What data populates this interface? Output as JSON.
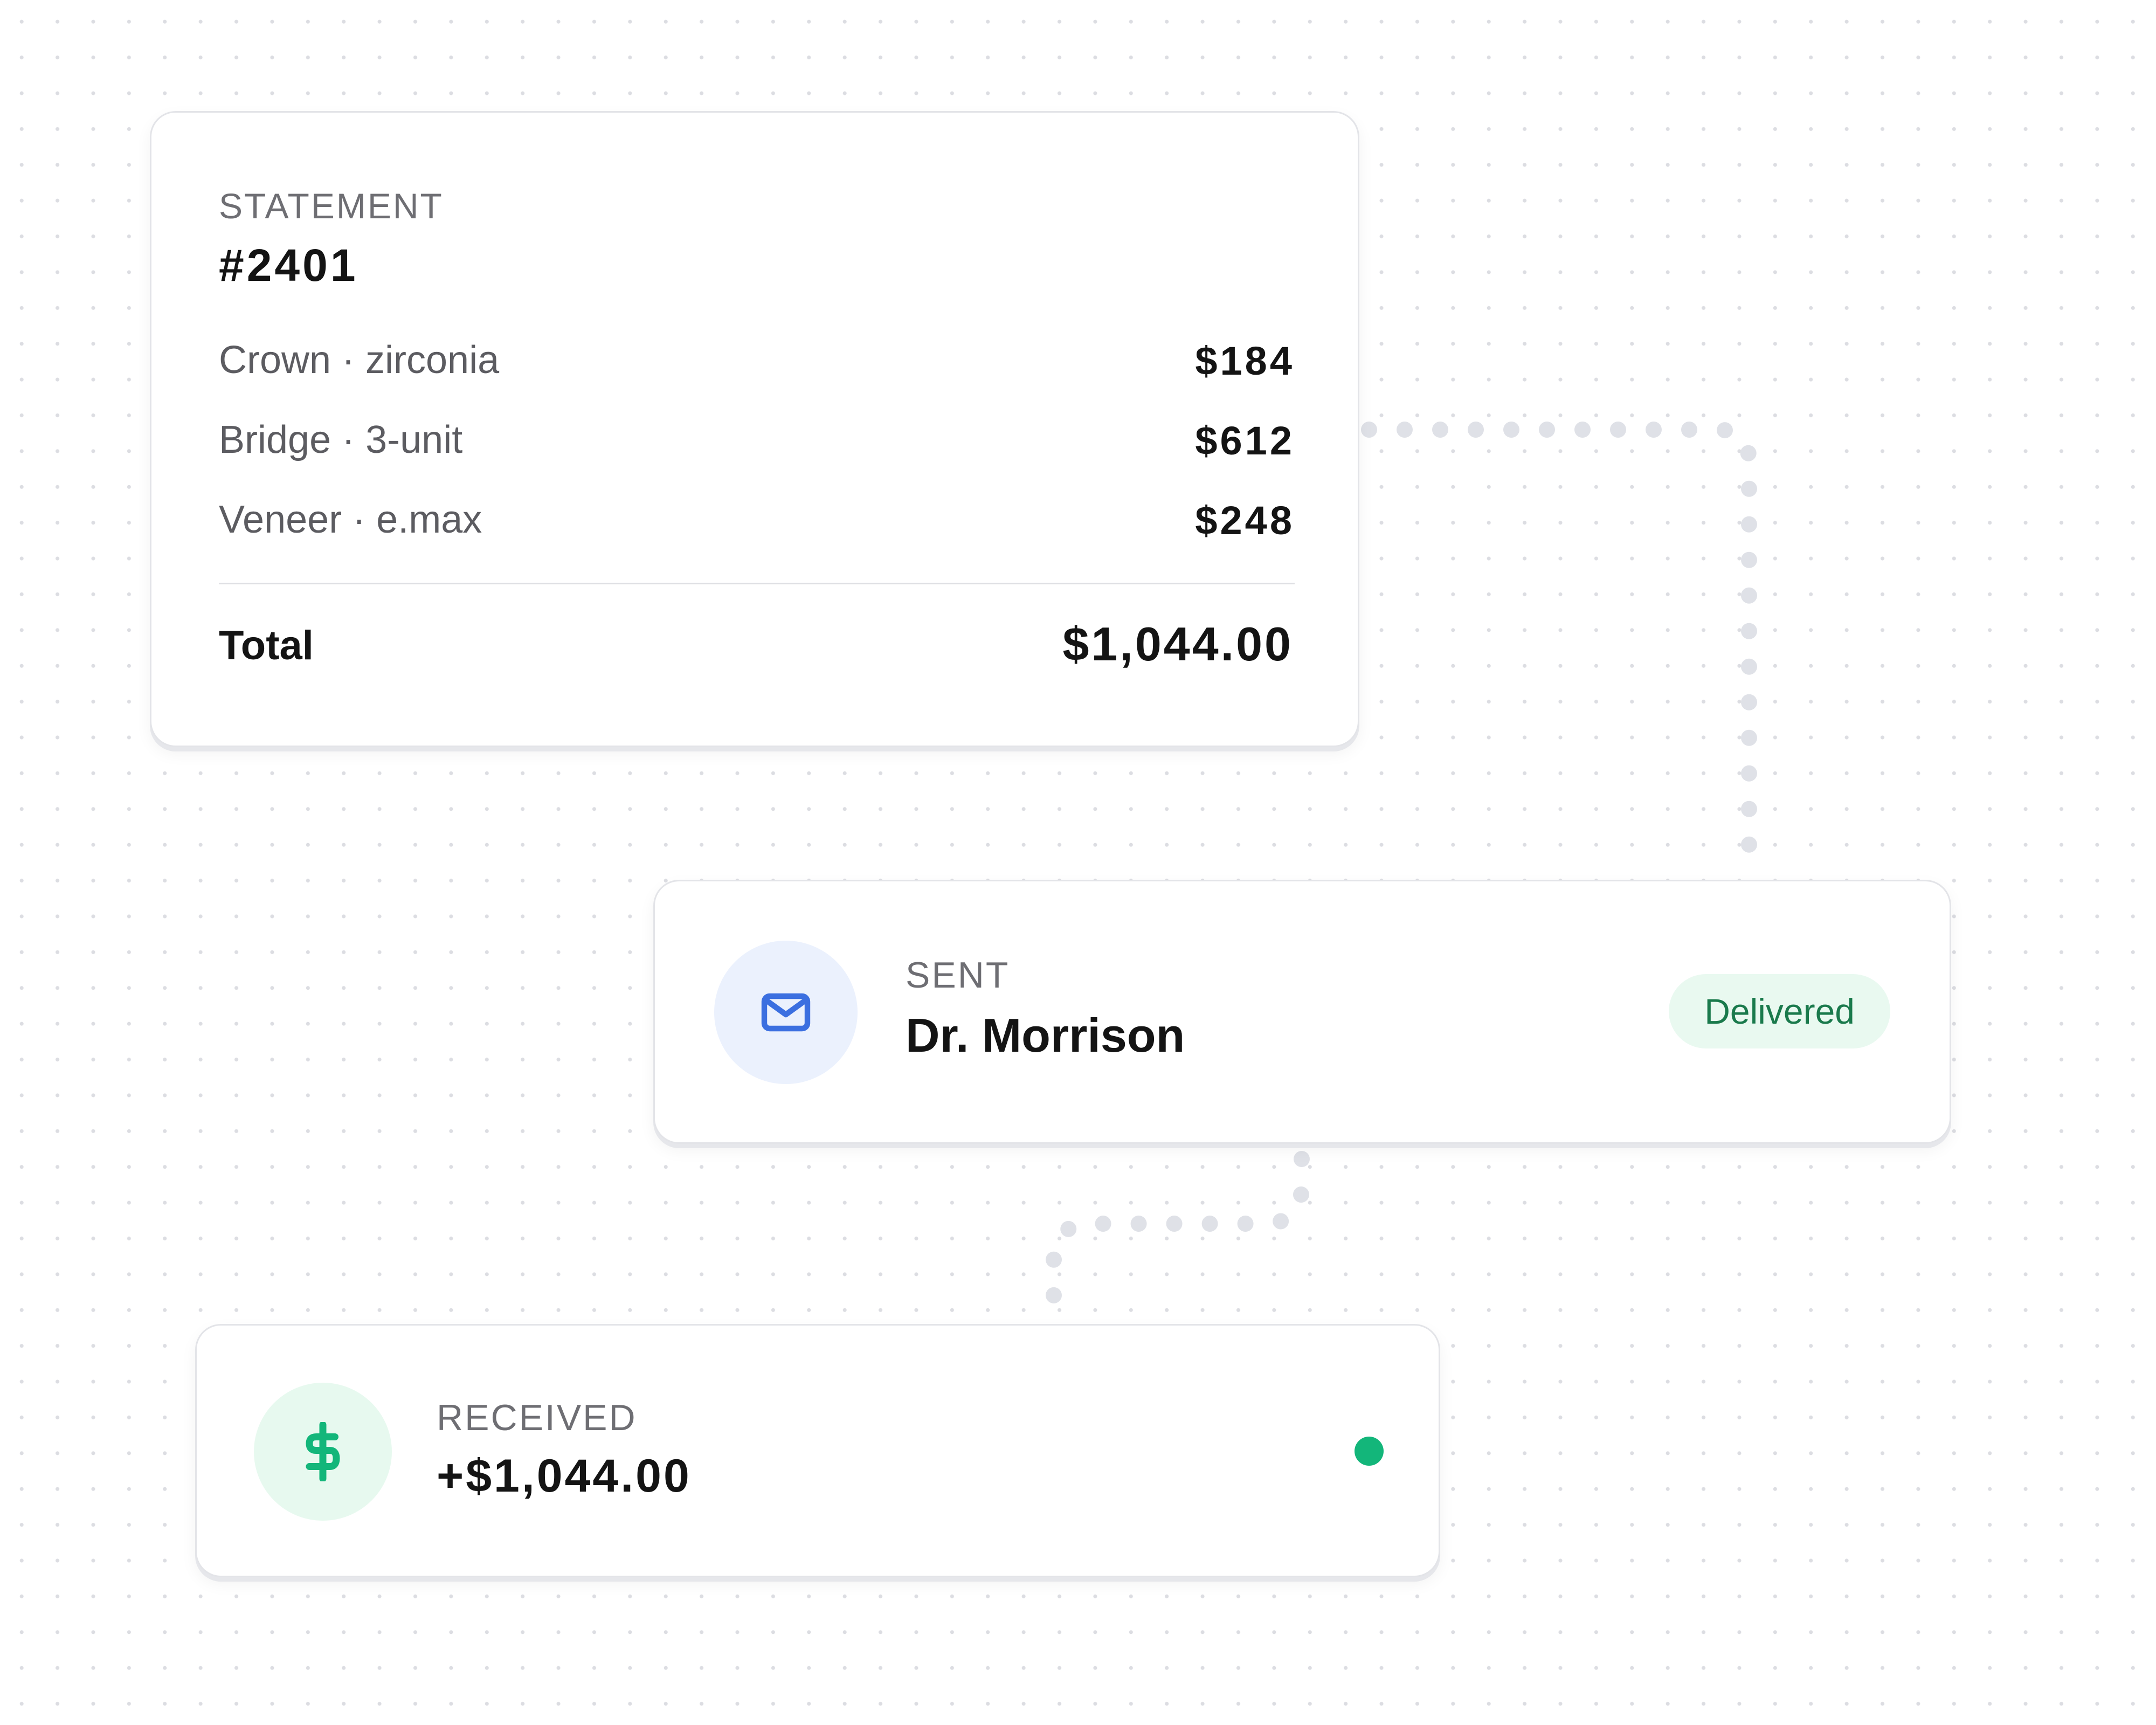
{
  "statement": {
    "label": "STATEMENT",
    "number": "#2401",
    "items": [
      {
        "name": "Crown · zirconia",
        "price": "$184"
      },
      {
        "name": "Bridge · 3-unit",
        "price": "$612"
      },
      {
        "name": "Veneer · e.max",
        "price": "$248"
      }
    ],
    "total_label": "Total",
    "total_value": "$1,044.00"
  },
  "sent": {
    "label": "SENT",
    "recipient": "Dr. Morrison",
    "status": "Delivered",
    "icon": "mail-icon"
  },
  "received": {
    "label": "RECEIVED",
    "amount": "+$1,044.00",
    "icon": "dollar-icon",
    "status_indicator": "status-dot"
  },
  "colors": {
    "accent_blue": "#3b6fe0",
    "accent_green": "#13b67a",
    "badge_text": "#1a7a4c",
    "badge_bg": "#e9f9f0"
  }
}
